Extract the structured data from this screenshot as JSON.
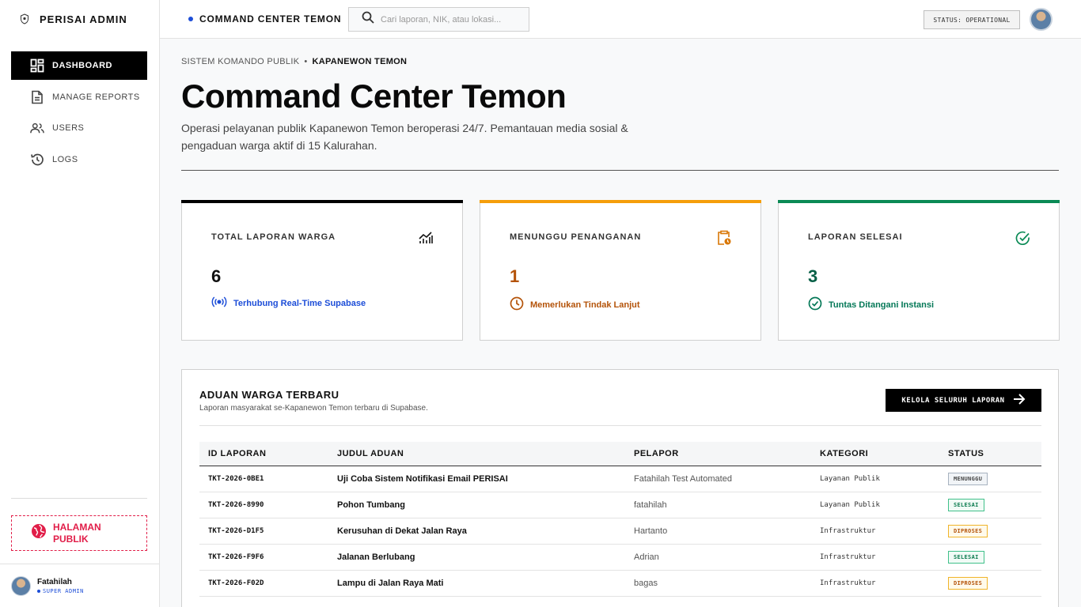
{
  "brand": {
    "name": "PERISAI ADMIN"
  },
  "nav": [
    {
      "label": "DASHBOARD",
      "icon": "dashboard-icon",
      "active": true
    },
    {
      "label": "MANAGE REPORTS",
      "icon": "document-icon",
      "active": false
    },
    {
      "label": "USERS",
      "icon": "users-icon",
      "active": false
    },
    {
      "label": "LOGS",
      "icon": "history-icon",
      "active": false
    }
  ],
  "public_link": {
    "label": "HALAMAN PUBLIK",
    "icon": "globe-icon",
    "color": "#e11d48"
  },
  "user": {
    "name": "Fatahilah",
    "role": "SUPER ADMIN"
  },
  "header": {
    "title": "COMMAND CENTER TEMON",
    "search_placeholder": "Cari laporan, NIK, atau lokasi...",
    "status": "STATUS: OPERATIONAL"
  },
  "breadcrumb": {
    "parent": "SISTEM KOMANDO PUBLIK",
    "separator": "•",
    "current": "KAPANEWON TEMON"
  },
  "page": {
    "title": "Command Center Temon",
    "description": "Operasi pelayanan publik Kapanewon Temon beroperasi 24/7. Pemantauan media sosial & pengaduan warga aktif di 15 Kalurahan."
  },
  "cards": [
    {
      "label": "TOTAL LAPORAN WARGA",
      "value": "6",
      "sub": "Terhubung Real-Time Supabase",
      "accent": "#000000",
      "value_color": "#111111",
      "sub_color": "#1d4ed8",
      "icon": "chart-icon",
      "sub_icon": "broadcast-icon"
    },
    {
      "label": "MENUNGGU PENANGANAN",
      "value": "1",
      "sub": "Memerlukan Tindak Lanjut",
      "accent": "#f59e0b",
      "value_color": "#b45309",
      "sub_color": "#b45309",
      "icon": "clipboard-clock-icon",
      "sub_icon": "clock-icon"
    },
    {
      "label": "LAPORAN SELESAI",
      "value": "3",
      "sub": "Tuntas Ditangani Instansi",
      "accent": "#0a8a55",
      "value_color": "#065f46",
      "sub_color": "#047857",
      "icon": "check-circle-icon",
      "sub_icon": "check-circle-icon"
    }
  ],
  "panel": {
    "title": "ADUAN WARGA TERBARU",
    "subtitle": "Laporan masyarakat se-Kapanewon Temon terbaru di Supabase.",
    "button": "KELOLA SELURUH LAPORAN",
    "columns": [
      "ID LAPORAN",
      "JUDUL ADUAN",
      "PELAPOR",
      "KATEGORI",
      "STATUS"
    ],
    "rows": [
      {
        "id": "TKT-2026-0BE1",
        "title": "Uji Coba Sistem Notifikasi Email PERISAI",
        "reporter": "Fatahilah Test Automated",
        "category": "Layanan Publik",
        "status": "MENUNGGU",
        "status_type": "wait"
      },
      {
        "id": "TKT-2026-8990",
        "title": "Pohon Tumbang",
        "reporter": "fatahilah",
        "category": "Layanan Publik",
        "status": "SELESAI",
        "status_type": "done"
      },
      {
        "id": "TKT-2026-D1F5",
        "title": "Kerusuhan di Dekat Jalan Raya",
        "reporter": "Hartanto",
        "category": "Infrastruktur",
        "status": "DIPROSES",
        "status_type": "proc"
      },
      {
        "id": "TKT-2026-F9F6",
        "title": "Jalanan Berlubang",
        "reporter": "Adrian",
        "category": "Infrastruktur",
        "status": "SELESAI",
        "status_type": "done"
      },
      {
        "id": "TKT-2026-F02D",
        "title": "Lampu di Jalan Raya Mati",
        "reporter": "bagas",
        "category": "Infrastruktur",
        "status": "DIPROSES",
        "status_type": "proc"
      }
    ]
  }
}
